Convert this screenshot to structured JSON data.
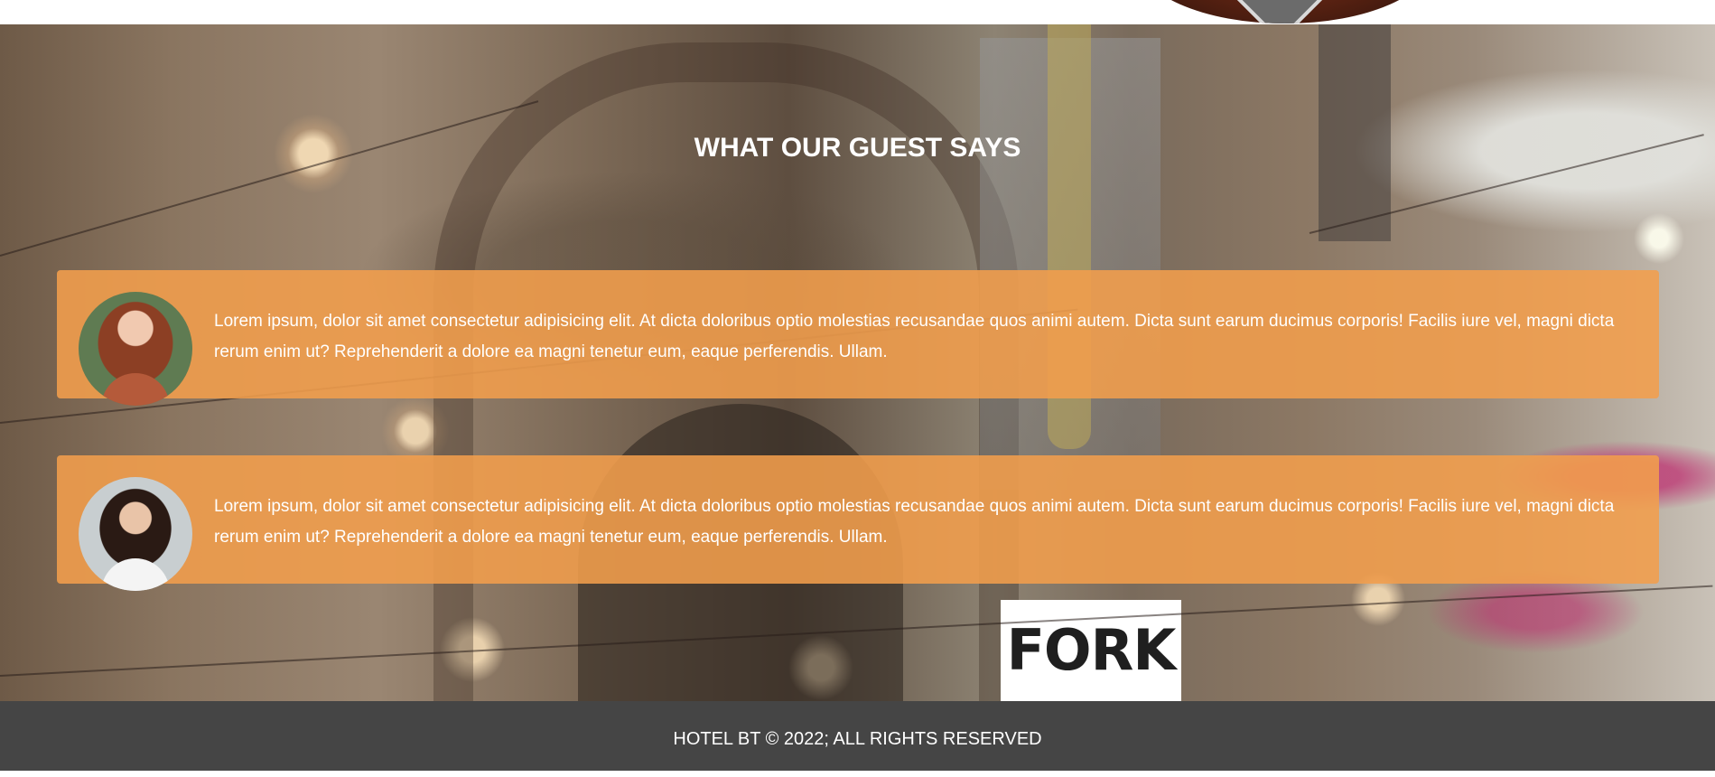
{
  "testimonials_section": {
    "heading": "WHAT OUR GUEST SAYS",
    "items": [
      {
        "text": "Lorem ipsum, dolor sit amet consectetur adipisicing elit. At dicta doloribus optio molestias recusandae quos animi autem. Dicta sunt earum ducimus corporis! Facilis iure vel, magni dicta rerum enim ut? Reprehenderit a dolore ea magni tenetur eum, eaque perferendis. Ullam."
      },
      {
        "text": "Lorem ipsum, dolor sit amet consectetur adipisicing elit. At dicta doloribus optio molestias recusandae quos animi autem. Dicta sunt earum ducimus corporis! Facilis iure vel, magni dicta rerum enim ut? Reprehenderit a dolore ea magni tenetur eum, eaque perferendis. Ullam."
      }
    ],
    "background_sign_text": "FORK"
  },
  "footer": {
    "text": "HOTEL BT © 2022; ALL RIGHTS RESERVED"
  },
  "colors": {
    "card_background": "#F29E4C",
    "footer_background": "#454545",
    "text": "#FFFFFF"
  }
}
